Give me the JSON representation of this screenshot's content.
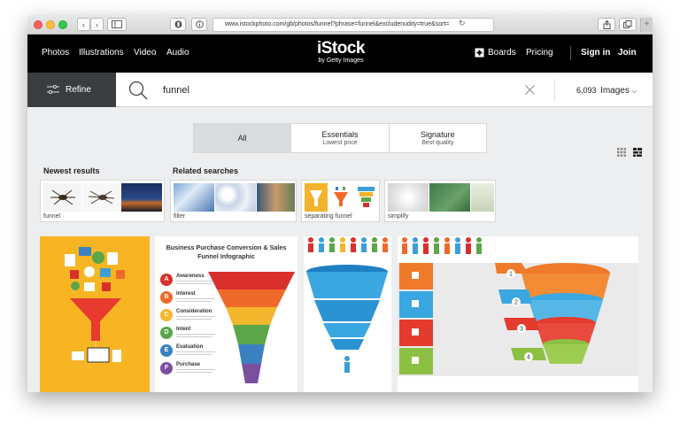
{
  "browser": {
    "url": "www.istockphoto.com/gb/photos/funnel?phrase=funnel&excludenudity=true&sort="
  },
  "nav": {
    "links": [
      "Photos",
      "Illustrations",
      "Video",
      "Audio"
    ],
    "logo_main": "iStock",
    "logo_sub": "by Getty Images",
    "boards": "Boards",
    "pricing": "Pricing",
    "sign_in": "Sign in",
    "join": "Join"
  },
  "search": {
    "refine_label": "Refine",
    "query": "funnel",
    "count": "6,093",
    "type_label": "Images"
  },
  "tabs": [
    {
      "title": "All",
      "subtitle": ""
    },
    {
      "title": "Essentials",
      "subtitle": "Lowest price"
    },
    {
      "title": "Signature",
      "subtitle": "Best quality"
    }
  ],
  "sections": {
    "newest": "Newest results",
    "related": "Related searches"
  },
  "cards": [
    {
      "label": "funnel"
    },
    {
      "label": "filter"
    },
    {
      "label": "separating funnel"
    },
    {
      "label": "simplify"
    }
  ],
  "infographic": {
    "title_line1": "Business Purchase Conversion & Sales",
    "title_line2": "Funnel Infographic",
    "stages": [
      {
        "letter": "A",
        "name": "Awareness",
        "color": "#d9302c"
      },
      {
        "letter": "B",
        "name": "Interest",
        "color": "#ef6a2a"
      },
      {
        "letter": "C",
        "name": "Consideration",
        "color": "#f3b72d"
      },
      {
        "letter": "D",
        "name": "Intent",
        "color": "#5aa648"
      },
      {
        "letter": "E",
        "name": "Evaluation",
        "color": "#3b80c1"
      },
      {
        "letter": "F",
        "name": "Purchase",
        "color": "#7b4fa0"
      }
    ],
    "steps3d": [
      "1",
      "2",
      "3",
      "4"
    ]
  }
}
